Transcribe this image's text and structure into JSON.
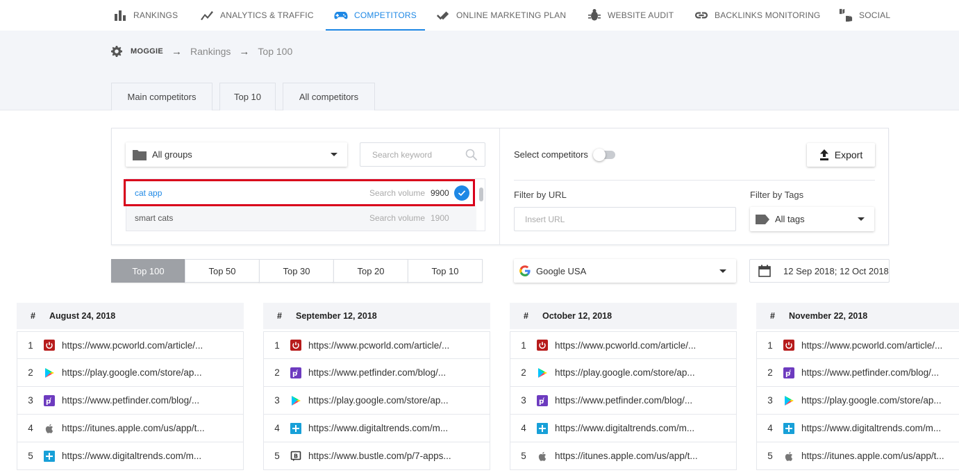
{
  "nav": {
    "items": [
      {
        "label": "RANKINGS",
        "icon": "bar-chart-icon"
      },
      {
        "label": "ANALYTICS & TRAFFIC",
        "icon": "trend-line-icon"
      },
      {
        "label": "COMPETITORS",
        "icon": "gamepad-icon",
        "active": true
      },
      {
        "label": "ONLINE MARKETING PLAN",
        "icon": "double-check-icon"
      },
      {
        "label": "WEBSITE AUDIT",
        "icon": "bug-icon"
      },
      {
        "label": "BACKLINKS MONITORING",
        "icon": "link-icon"
      },
      {
        "label": "SOCIAL",
        "icon": "thumbs-icon"
      }
    ],
    "accent": "#1e88e5"
  },
  "breadcrumb": {
    "project": "MOGGIE",
    "items": [
      "Rankings",
      "Top 100"
    ],
    "separator": "→"
  },
  "subtabs": [
    "Main competitors",
    "Top 10",
    "All competitors"
  ],
  "filters": {
    "groups": {
      "value": "All groups"
    },
    "search": {
      "placeholder": "Search keyword"
    },
    "keywords": [
      {
        "keyword": "cat app",
        "volume_label": "Search volume",
        "volume": "9900",
        "selected": true
      },
      {
        "keyword": "smart cats",
        "volume_label": "Search volume",
        "volume": "1900",
        "selected": false
      }
    ],
    "select_competitors": "Select competitors",
    "export_label": "Export",
    "filter_url_label": "Filter by URL",
    "url_placeholder": "Insert URL",
    "filter_tags_label": "Filter by Tags",
    "tags_value": "All tags"
  },
  "top_tabs": [
    "Top 100",
    "Top 50",
    "Top 30",
    "Top 20",
    "Top 10"
  ],
  "engine": "Google USA",
  "date_range": "12 Sep 2018; 12 Oct 2018",
  "columns": [
    {
      "hash": "#",
      "date": "August 24, 2018",
      "rows": [
        {
          "n": "1",
          "icon": "pcworld-icon",
          "url": "https://www.pcworld.com/article/..."
        },
        {
          "n": "2",
          "icon": "google-play-icon",
          "url": "https://play.google.com/store/ap..."
        },
        {
          "n": "3",
          "icon": "petfinder-icon",
          "url": "https://www.petfinder.com/blog/..."
        },
        {
          "n": "4",
          "icon": "apple-icon",
          "url": "https://itunes.apple.com/us/app/t..."
        },
        {
          "n": "5",
          "icon": "digitaltrends-icon",
          "url": "https://www.digitaltrends.com/m..."
        }
      ]
    },
    {
      "hash": "#",
      "date": "September 12, 2018",
      "rows": [
        {
          "n": "1",
          "icon": "pcworld-icon",
          "url": "https://www.pcworld.com/article/..."
        },
        {
          "n": "2",
          "icon": "petfinder-icon",
          "url": "https://www.petfinder.com/blog/..."
        },
        {
          "n": "3",
          "icon": "google-play-icon",
          "url": "https://play.google.com/store/ap..."
        },
        {
          "n": "4",
          "icon": "digitaltrends-icon",
          "url": "https://www.digitaltrends.com/m..."
        },
        {
          "n": "5",
          "icon": "bustle-icon",
          "url": "https://www.bustle.com/p/7-apps..."
        }
      ]
    },
    {
      "hash": "#",
      "date": "October 12, 2018",
      "rows": [
        {
          "n": "1",
          "icon": "pcworld-icon",
          "url": "https://www.pcworld.com/article/..."
        },
        {
          "n": "2",
          "icon": "google-play-icon",
          "url": "https://play.google.com/store/ap..."
        },
        {
          "n": "3",
          "icon": "petfinder-icon",
          "url": "https://www.petfinder.com/blog/..."
        },
        {
          "n": "4",
          "icon": "digitaltrends-icon",
          "url": "https://www.digitaltrends.com/m..."
        },
        {
          "n": "5",
          "icon": "apple-icon",
          "url": "https://itunes.apple.com/us/app/t..."
        }
      ]
    },
    {
      "hash": "#",
      "date": "November 22, 2018",
      "rows": [
        {
          "n": "1",
          "icon": "pcworld-icon",
          "url": "https://www.pcworld.com/article/..."
        },
        {
          "n": "2",
          "icon": "petfinder-icon",
          "url": "https://www.petfinder.com/blog/..."
        },
        {
          "n": "3",
          "icon": "google-play-icon",
          "url": "https://play.google.com/store/ap..."
        },
        {
          "n": "4",
          "icon": "digitaltrends-icon",
          "url": "https://www.digitaltrends.com/m..."
        },
        {
          "n": "5",
          "icon": "apple-icon",
          "url": "https://itunes.apple.com/us/app/t..."
        }
      ]
    }
  ]
}
